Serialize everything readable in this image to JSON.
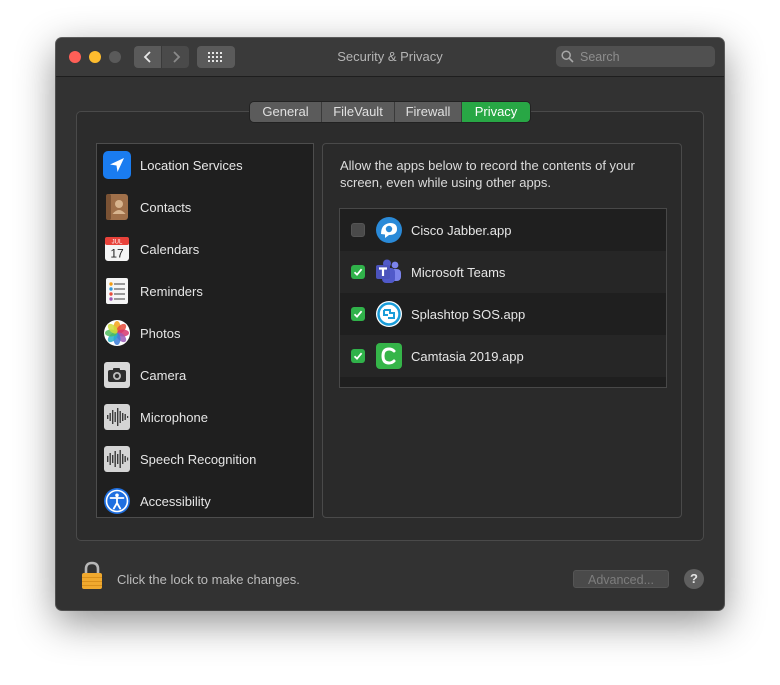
{
  "window": {
    "title": "Security & Privacy"
  },
  "search": {
    "placeholder": "Search"
  },
  "tabs": [
    {
      "label": "General"
    },
    {
      "label": "FileVault"
    },
    {
      "label": "Firewall"
    },
    {
      "label": "Privacy",
      "active": true
    }
  ],
  "sidebar": {
    "items": [
      {
        "label": "Location Services",
        "icon": "location-arrow-icon"
      },
      {
        "label": "Contacts",
        "icon": "contacts-book-icon"
      },
      {
        "label": "Calendars",
        "icon": "calendar-icon",
        "icon_month": "JUL",
        "icon_day": "17"
      },
      {
        "label": "Reminders",
        "icon": "reminders-list-icon"
      },
      {
        "label": "Photos",
        "icon": "photos-flower-icon"
      },
      {
        "label": "Camera",
        "icon": "camera-icon"
      },
      {
        "label": "Microphone",
        "icon": "microphone-waveform-icon"
      },
      {
        "label": "Speech Recognition",
        "icon": "speech-waveform-icon"
      },
      {
        "label": "Accessibility",
        "icon": "accessibility-icon"
      }
    ]
  },
  "main": {
    "description": "Allow the apps below to record the contents of your screen, even while using other apps.",
    "apps": [
      {
        "name": "Cisco Jabber.app",
        "checked": false,
        "icon": "cisco-jabber-icon"
      },
      {
        "name": "Microsoft Teams",
        "checked": true,
        "icon": "microsoft-teams-icon"
      },
      {
        "name": "Splashtop SOS.app",
        "checked": true,
        "icon": "splashtop-icon"
      },
      {
        "name": "Camtasia 2019.app",
        "checked": true,
        "icon": "camtasia-icon"
      }
    ]
  },
  "footer": {
    "lock_text": "Click the lock to make changes.",
    "advanced_label": "Advanced...",
    "help_label": "?"
  },
  "colors": {
    "accent_green": "#28a745",
    "checkbox_green": "#30b24a",
    "window_bg": "#323232"
  }
}
